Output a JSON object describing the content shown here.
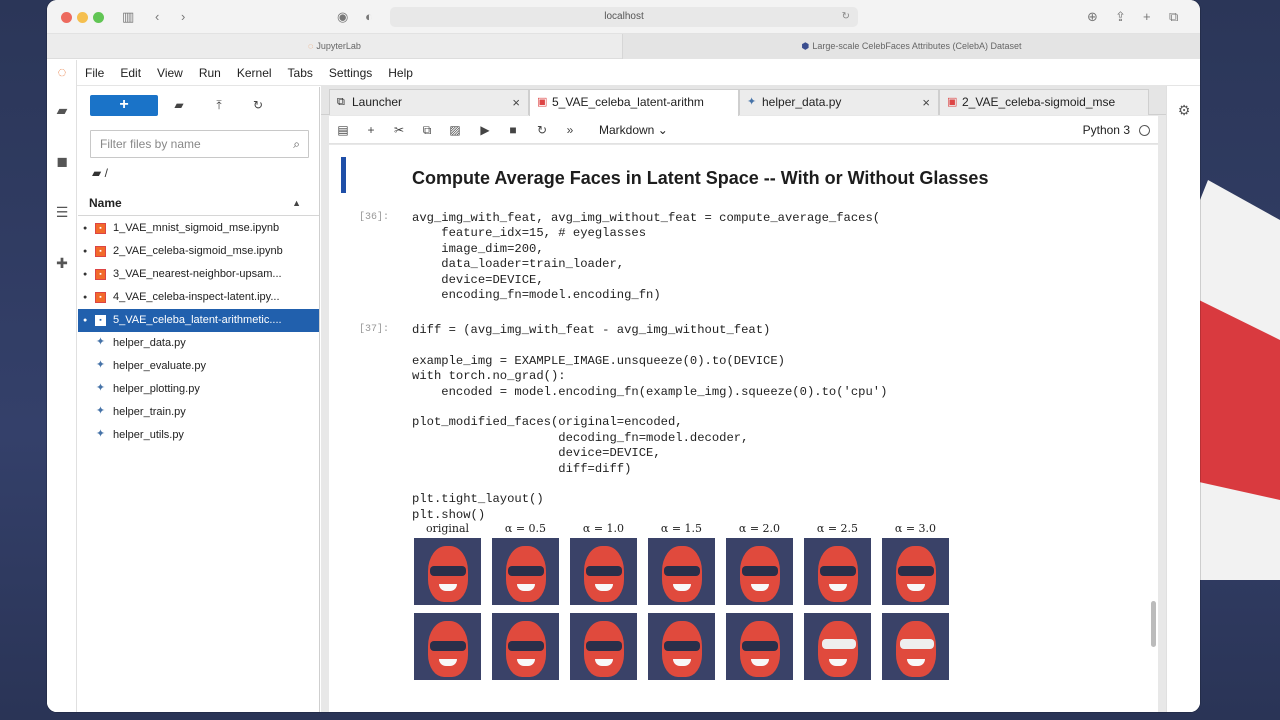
{
  "browser": {
    "address": "localhost",
    "tabs": [
      {
        "label": "JupyterLab"
      },
      {
        "label": "Large-scale CelebFaces Attributes (CelebA) Dataset"
      }
    ]
  },
  "menubar": [
    "File",
    "Edit",
    "View",
    "Run",
    "Kernel",
    "Tabs",
    "Settings",
    "Help"
  ],
  "filebrowser": {
    "new_label": "+",
    "filter_placeholder": "Filter files by name",
    "breadcrumb": "/",
    "header": "Name",
    "files": [
      {
        "name": "1_VAE_mnist_sigmoid_mse.ipynb",
        "type": "notebook",
        "running": true,
        "selected": false
      },
      {
        "name": "2_VAE_celeba-sigmoid_mse.ipynb",
        "type": "notebook",
        "running": true,
        "selected": false
      },
      {
        "name": "3_VAE_nearest-neighbor-upsam...",
        "type": "notebook",
        "running": true,
        "selected": false
      },
      {
        "name": "4_VAE_celeba-inspect-latent.ipy...",
        "type": "notebook",
        "running": true,
        "selected": false
      },
      {
        "name": "5_VAE_celeba_latent-arithmetic....",
        "type": "notebook",
        "running": true,
        "selected": true
      },
      {
        "name": "helper_data.py",
        "type": "python",
        "running": false,
        "selected": false
      },
      {
        "name": "helper_evaluate.py",
        "type": "python",
        "running": false,
        "selected": false
      },
      {
        "name": "helper_plotting.py",
        "type": "python",
        "running": false,
        "selected": false
      },
      {
        "name": "helper_train.py",
        "type": "python",
        "running": false,
        "selected": false
      },
      {
        "name": "helper_utils.py",
        "type": "python",
        "running": false,
        "selected": false
      }
    ]
  },
  "doctabs": [
    {
      "label": "Launcher",
      "kind": "launcher",
      "active": false
    },
    {
      "label": "5_VAE_celeba_latent-arithm",
      "kind": "notebook",
      "active": true
    },
    {
      "label": "helper_data.py",
      "kind": "python",
      "active": false
    },
    {
      "label": "2_VAE_celeba-sigmoid_mse",
      "kind": "notebook",
      "active": false
    }
  ],
  "toolbar": {
    "cell_type": "Markdown",
    "kernel": "Python 3"
  },
  "notebook": {
    "heading": "Compute Average Faces in Latent Space -- With or Without Glasses",
    "cells": [
      {
        "prompt": "[36]:",
        "lines": [
          "avg_img_with_feat, avg_img_without_feat = compute_average_faces(",
          "    feature_idx=15, # eyeglasses",
          "    image_dim=200,",
          "    data_loader=train_loader,",
          "    device=DEVICE,",
          "    encoding_fn=model.encoding_fn)"
        ]
      },
      {
        "prompt": "[37]:",
        "lines": [
          "diff = (avg_img_with_feat - avg_img_without_feat)",
          "",
          "example_img = EXAMPLE_IMAGE.unsqueeze(0).to(DEVICE)",
          "with torch.no_grad():",
          "    encoded = model.encoding_fn(example_img).squeeze(0).to('cpu')",
          "",
          "plot_modified_faces(original=encoded,",
          "                    decoding_fn=model.decoder,",
          "                    device=DEVICE,",
          "                    diff=diff)",
          "",
          "plt.tight_layout()",
          "plt.show()"
        ]
      }
    ],
    "output_labels": [
      "original",
      "α = 0.5",
      "α = 1.0",
      "α = 1.5",
      "α = 2.0",
      "α = 2.5",
      "α = 3.0"
    ]
  }
}
